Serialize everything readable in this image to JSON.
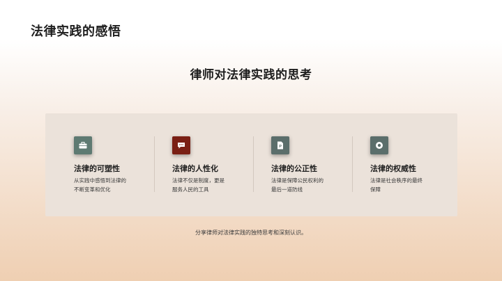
{
  "slide": {
    "title": "法律实践的感悟",
    "heading": "律师对法律实践的思考",
    "footnote": "分享律师对法律实践的独特思考和深刻认识。"
  },
  "cards": [
    {
      "title": "法律的可塑性",
      "desc_line1": "从实践中感悟到法律的",
      "desc_line2": "不断变革和优化",
      "icon": "briefcase-icon",
      "color": "#5e7a72"
    },
    {
      "title": "法律的人性化",
      "desc_line1": "法律不仅是制度，更是",
      "desc_line2": "服务人民的工具",
      "icon": "chat-icon",
      "color": "#7a1f14"
    },
    {
      "title": "法律的公正性",
      "desc_line1": "法律是保障公民权利的",
      "desc_line2": "最后一道防线",
      "icon": "document-icon",
      "color": "#5b6e6b"
    },
    {
      "title": "法律的权威性",
      "desc_line1": "法律是社会秩序的最终",
      "desc_line2": "保障",
      "icon": "circle-icon",
      "color": "#5b6e6b"
    }
  ]
}
